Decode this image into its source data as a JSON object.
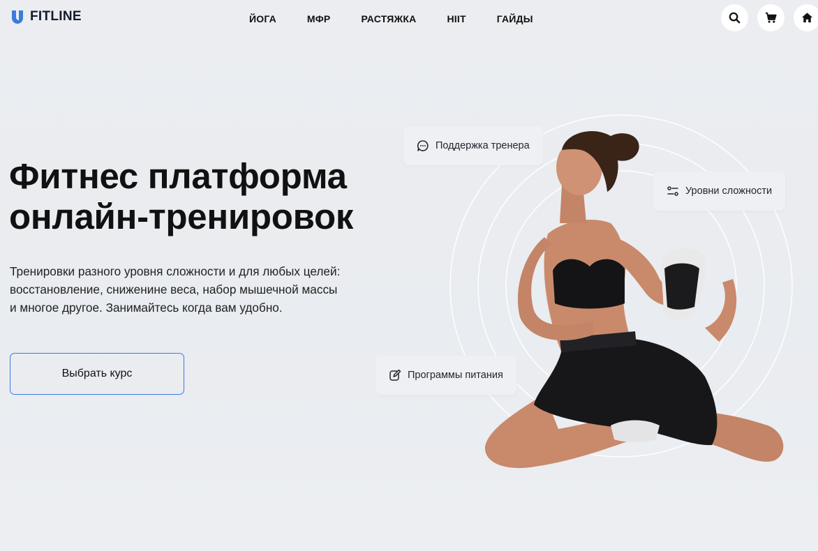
{
  "brand": {
    "name": "FITLINE",
    "accent": "#3c7bdc"
  },
  "nav": {
    "items": [
      {
        "label": "ЙОГА"
      },
      {
        "label": "МФР"
      },
      {
        "label": "РАСТЯЖКА"
      },
      {
        "label": "HIIT"
      },
      {
        "label": "ГАЙДЫ"
      }
    ]
  },
  "header_actions": [
    {
      "icon": "search-icon"
    },
    {
      "icon": "cart-icon"
    },
    {
      "icon": "home-icon"
    }
  ],
  "hero": {
    "title_line1": "Фитнес платформа",
    "title_line2": "онлайн-тренировок",
    "desc_line1": "Тренировки разного уровня сложности и для любых целей:",
    "desc_line2": "восстановление, сниженине веса, набор мышечной массы",
    "desc_line3": "и многое другое. Занимайтесь когда вам удобно.",
    "cta_label": "Выбрать курс"
  },
  "features": {
    "support": {
      "label": "Поддержка тренера",
      "icon": "chat-icon"
    },
    "levels": {
      "label": "Уровни сложности",
      "icon": "sliders-icon"
    },
    "nutrition": {
      "label": "Программы питания",
      "icon": "edit-icon"
    }
  }
}
